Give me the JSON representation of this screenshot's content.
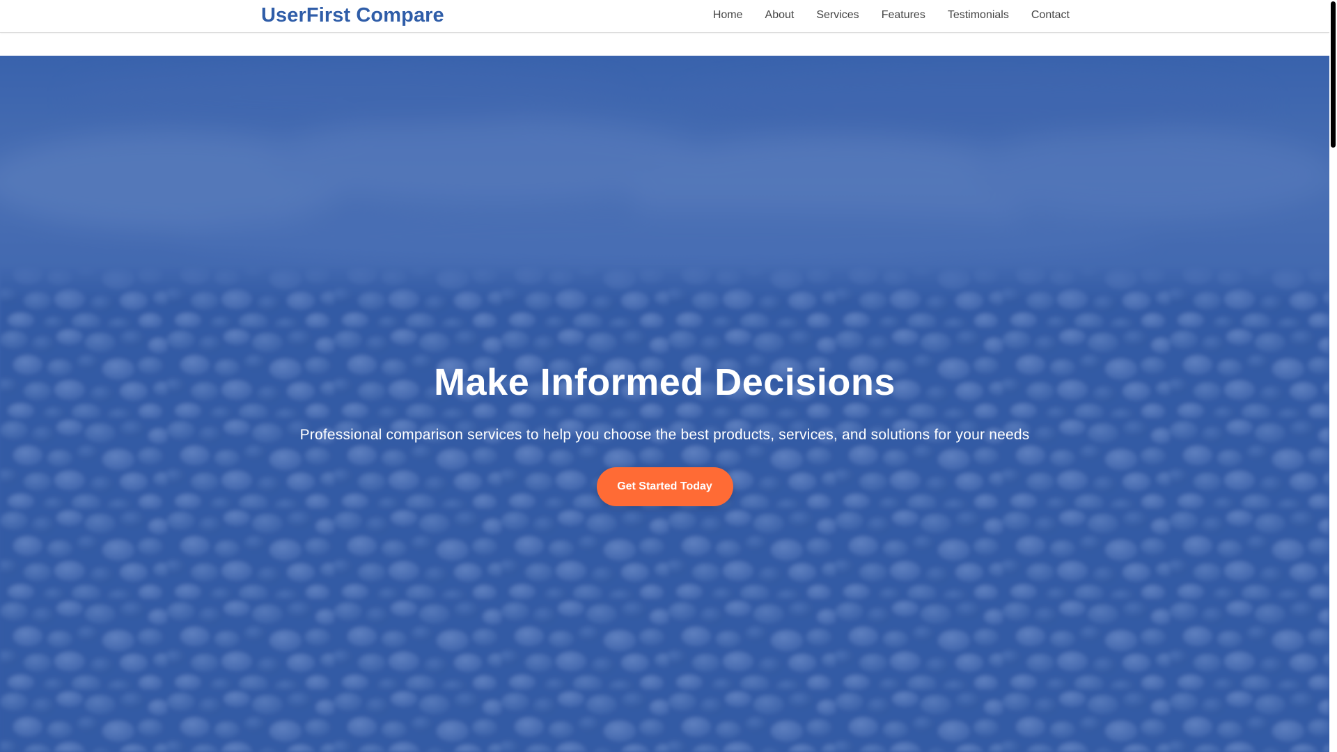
{
  "header": {
    "brand": "UserFirst Compare",
    "nav": [
      "Home",
      "About",
      "Services",
      "Features",
      "Testimonials",
      "Contact"
    ]
  },
  "hero": {
    "title": "Make Informed Decisions",
    "subtitle": "Professional comparison services to help you choose the best products, services, and solutions for your needs",
    "cta_label": "Get Started Today"
  },
  "colors": {
    "brand": "#2f5da8",
    "nav_text": "#444444",
    "hero_overlay": "#2c58aa",
    "cta": "#ff6b35",
    "scroll_thumb": "#000000"
  },
  "icons": {
    "background_image": "pebble-beach-photo"
  }
}
